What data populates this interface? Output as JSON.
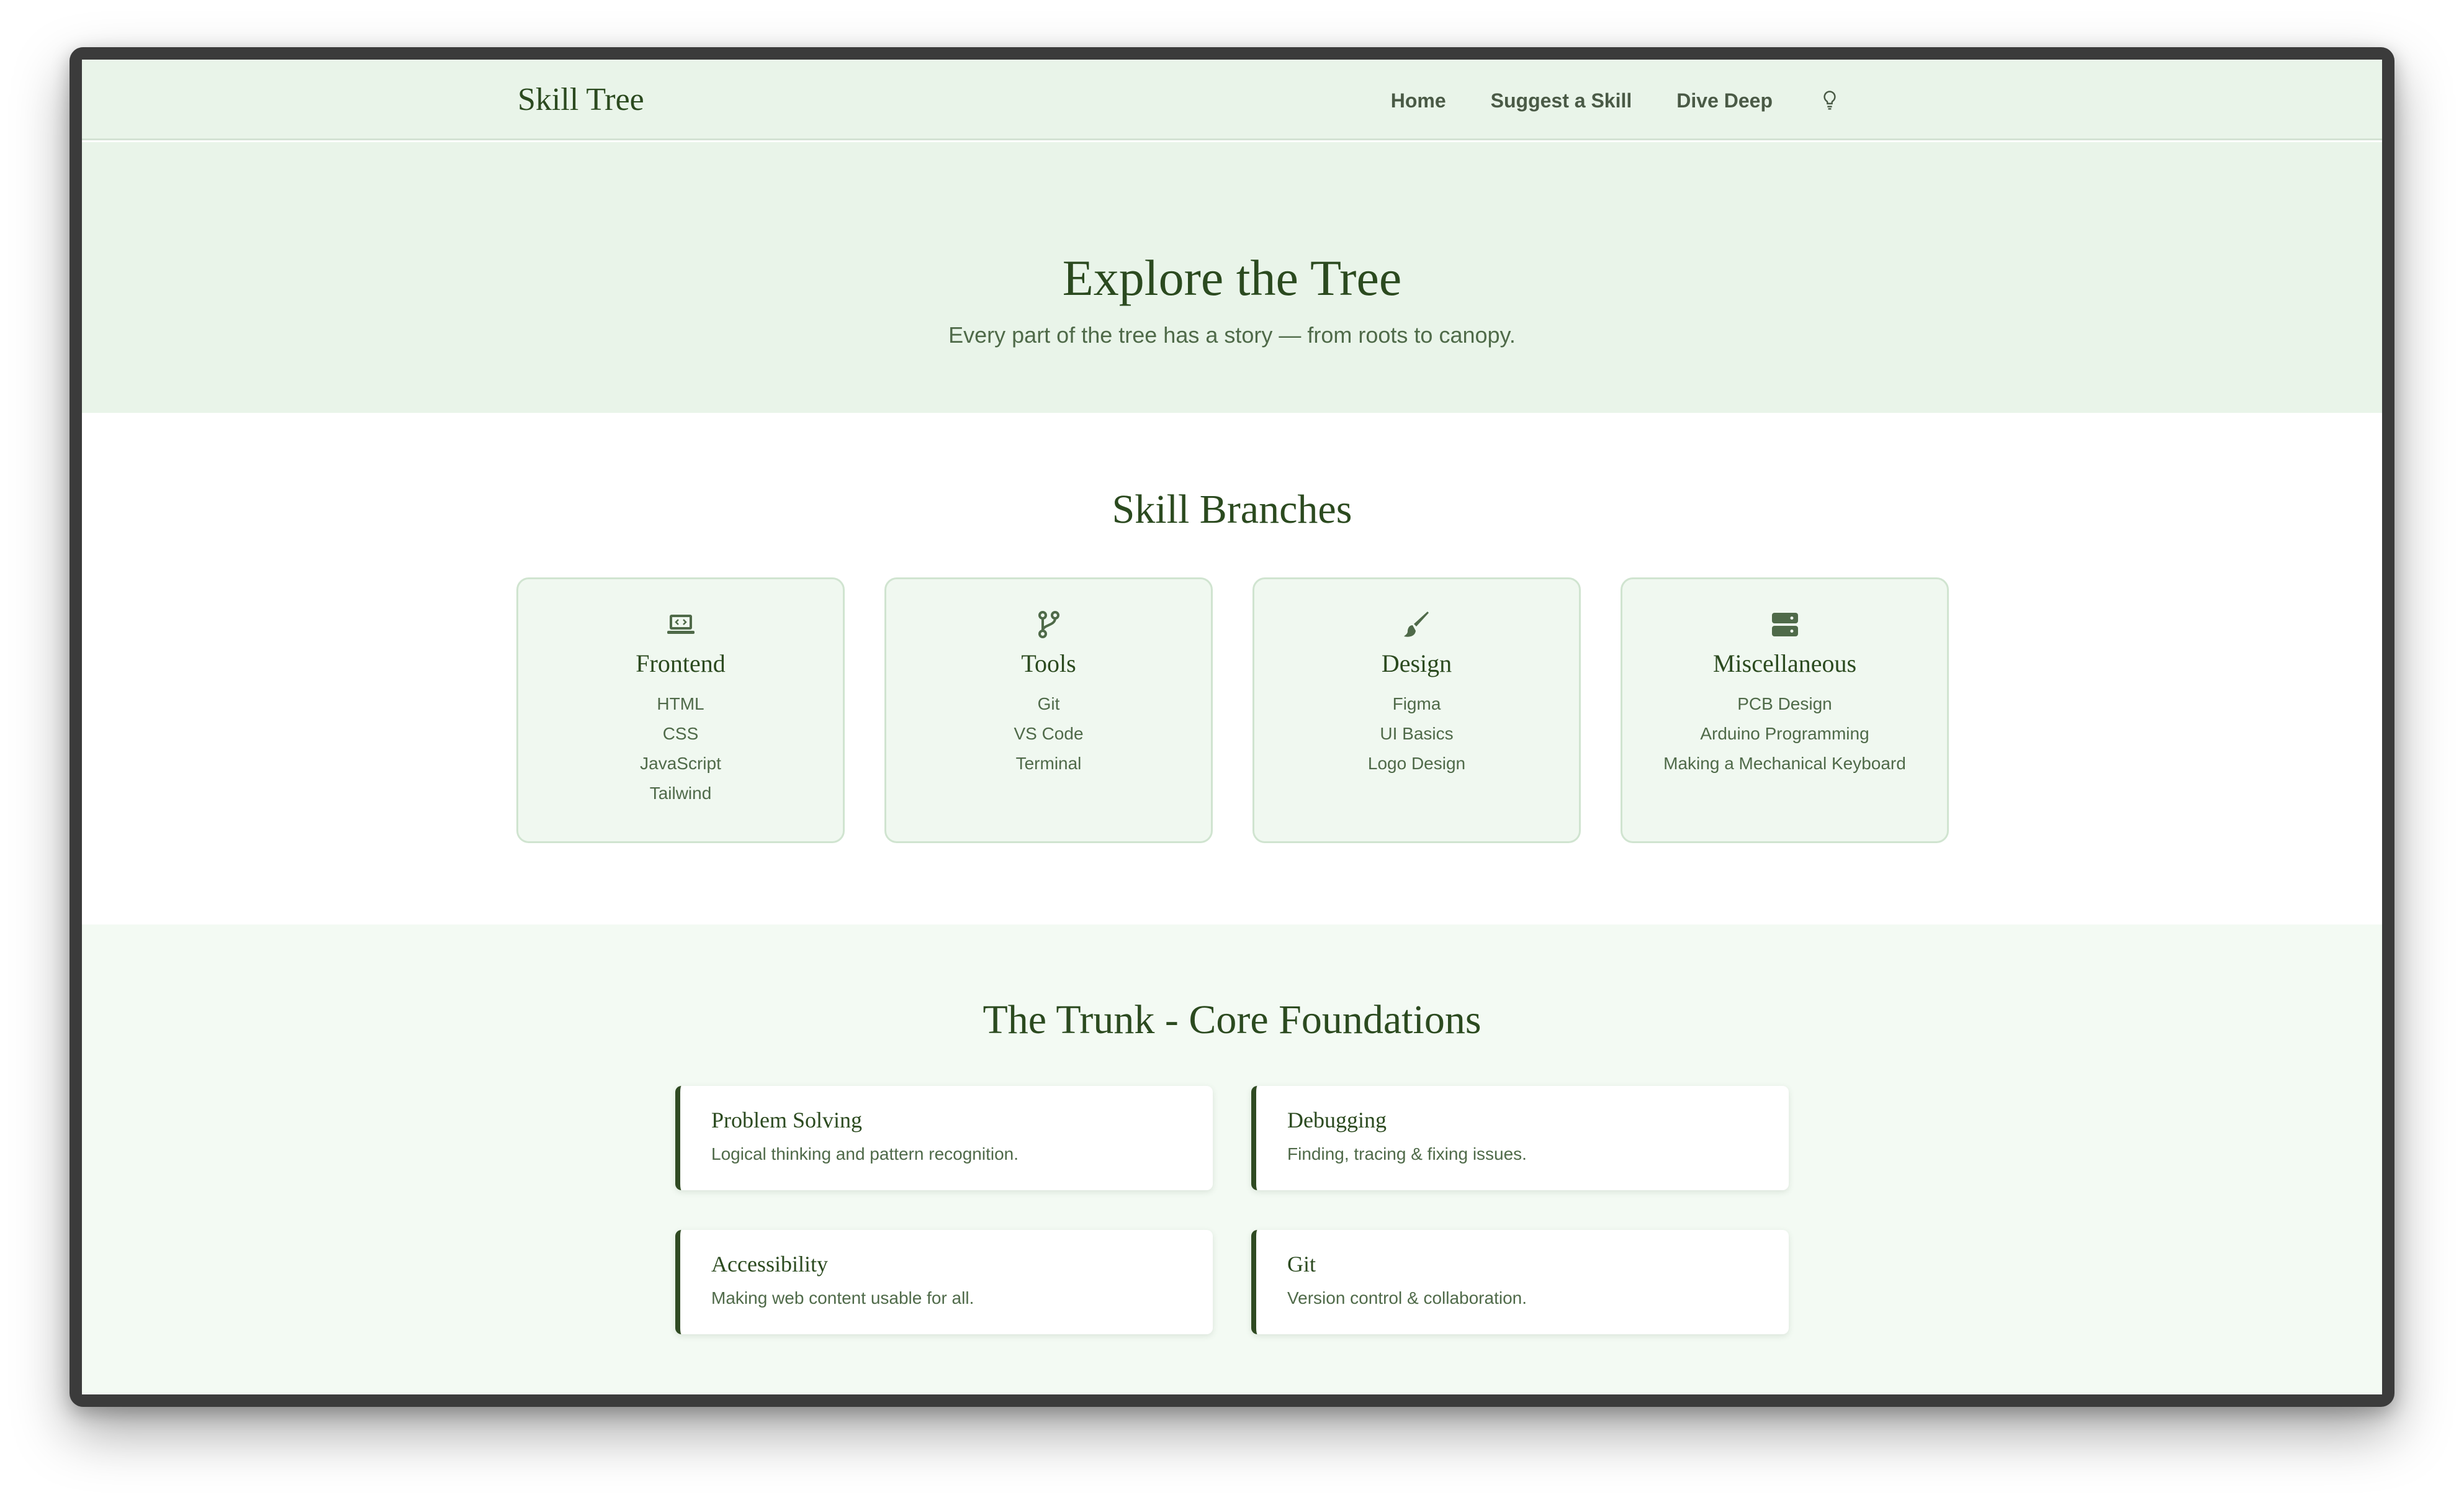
{
  "nav": {
    "brand": "Skill Tree",
    "links": [
      "Home",
      "Suggest a Skill",
      "Dive Deep"
    ],
    "theme_icon": "lightbulb-icon"
  },
  "hero": {
    "title": "Explore the Tree",
    "subtitle": "Every part of the tree has a story — from roots to canopy."
  },
  "branches": {
    "title": "Skill Branches",
    "cards": [
      {
        "icon": "laptop-code-icon",
        "title": "Frontend",
        "items": [
          "HTML",
          "CSS",
          "JavaScript",
          "Tailwind"
        ]
      },
      {
        "icon": "git-branch-icon",
        "title": "Tools",
        "items": [
          "Git",
          "VS Code",
          "Terminal"
        ]
      },
      {
        "icon": "paintbrush-icon",
        "title": "Design",
        "items": [
          "Figma",
          "UI Basics",
          "Logo Design"
        ]
      },
      {
        "icon": "server-icon",
        "title": "Miscellaneous",
        "items": [
          "PCB Design",
          "Arduino Programming",
          "Making a Mechanical Keyboard"
        ]
      }
    ]
  },
  "trunk": {
    "title": "The Trunk - Core Foundations",
    "cards": [
      {
        "title": "Problem Solving",
        "desc": "Logical thinking and pattern recognition."
      },
      {
        "title": "Debugging",
        "desc": "Finding, tracing & fixing issues."
      },
      {
        "title": "Accessibility",
        "desc": "Making web content usable for all."
      },
      {
        "title": "Git",
        "desc": "Version control & collaboration."
      }
    ]
  },
  "colors": {
    "primary": "#2b4a1f",
    "text_muted": "#4f6a49",
    "hero_bg": "#e9f4e9",
    "card_bg": "#f0f8f0",
    "trunk_bg": "#f3faf3"
  }
}
